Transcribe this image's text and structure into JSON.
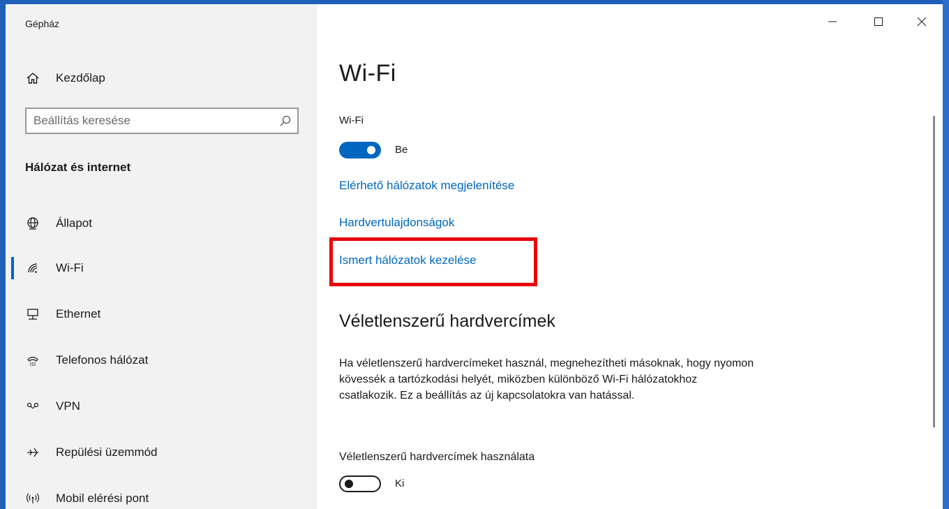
{
  "window": {
    "title": "Gépház"
  },
  "sidebar": {
    "home_label": "Kezdőlap",
    "search_placeholder": "Beállítás keresése",
    "section_title": "Hálózat és internet",
    "items": [
      {
        "label": "Állapot",
        "icon": "globe-status-icon"
      },
      {
        "label": "Wi-Fi",
        "icon": "wifi-icon",
        "selected": true
      },
      {
        "label": "Ethernet",
        "icon": "ethernet-icon"
      },
      {
        "label": "Telefonos hálózat",
        "icon": "dialup-icon"
      },
      {
        "label": "VPN",
        "icon": "vpn-icon"
      },
      {
        "label": "Repülési üzemmód",
        "icon": "airplane-icon"
      },
      {
        "label": "Mobil elérési pont",
        "icon": "hotspot-icon"
      }
    ]
  },
  "main": {
    "title": "Wi-Fi",
    "wifi_toggle_label": "Wi-Fi",
    "wifi_toggle_state": "Be",
    "links": {
      "show_networks": "Elérhető hálózatok megjelenítése",
      "hardware_props": "Hardvertulajdonságok",
      "manage_known": "Ismert hálózatok kezelése"
    },
    "random_section_title": "Véletlenszerű hardvercímek",
    "random_description": "Ha véletlenszerű hardvercímeket használ, megnehezítheti másoknak, hogy nyomon kövessék a tartózkodási helyét, miközben különböző Wi-Fi hálózatokhoz csatlakozik. Ez a beállítás az új kapcsolatokra van hatással.",
    "random_toggle_label": "Véletlenszerű hardvercímek használata",
    "random_toggle_state": "Ki"
  },
  "colors": {
    "accent": "#0067c0",
    "highlight": "#e8000a",
    "sidebar_bg": "#f2f2f2"
  }
}
